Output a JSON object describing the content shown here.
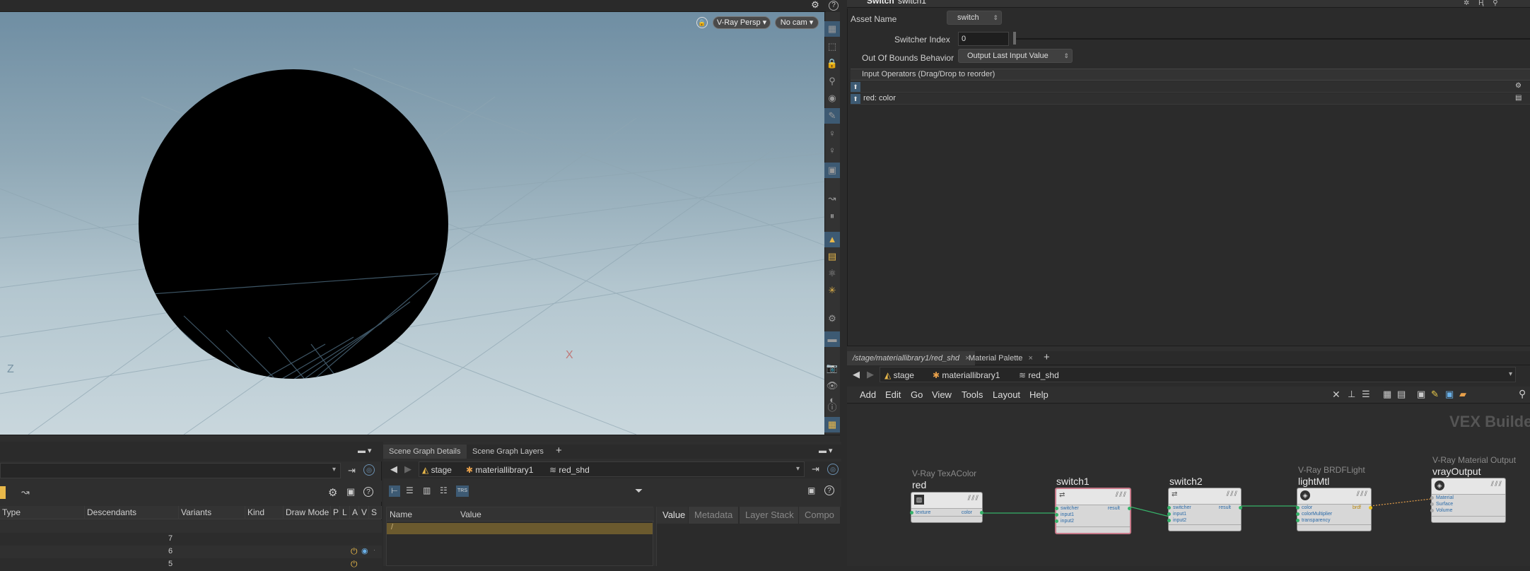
{
  "viewport": {
    "camera_menu": "V-Ray Persp",
    "cam_menu": "No cam",
    "bg_top": "#6f8ea3",
    "bg_bottom": "#c9d7dd"
  },
  "params": {
    "header_type": "Switch",
    "header_name": "switch1",
    "asset_name_label": "Asset Name",
    "asset_name_value": "switch",
    "switcher_index_label": "Switcher Index",
    "switcher_index_value": "0",
    "oob_label": "Out Of Bounds Behavior",
    "oob_value": "Output Last Input Value",
    "input_ops_label": "Input Operators (Drag/Drop to reorder)",
    "input_row_2": "red: color"
  },
  "network": {
    "tabs": [
      {
        "label": "/stage/materiallibrary1/red_shd",
        "close": "×"
      },
      {
        "label": "Material Palette",
        "close": "×"
      }
    ],
    "add_tab": "+",
    "path": [
      "stage",
      "materiallibrary1",
      "red_shd"
    ],
    "menu": [
      "Add",
      "Edit",
      "Go",
      "View",
      "Tools",
      "Layout",
      "Help"
    ],
    "watermark": "VEX Builder",
    "nodes": [
      {
        "type": "V-Ray TexAColor",
        "name": "red",
        "inputs": [
          "texture"
        ],
        "outputs": [
          "color"
        ]
      },
      {
        "type": "",
        "name": "switch1",
        "inputs": [
          "switcher",
          "input1",
          "input2"
        ],
        "outputs": [
          "result"
        ]
      },
      {
        "type": "",
        "name": "switch2",
        "inputs": [
          "switcher",
          "input1",
          "input2"
        ],
        "outputs": [
          "result"
        ]
      },
      {
        "type": "V-Ray BRDFLight",
        "name": "lightMtl",
        "inputs": [
          "color",
          "colorMultiplier",
          "transparency"
        ],
        "outputs": [
          "brdf"
        ]
      },
      {
        "type": "V-Ray Material Output",
        "name": "vrayOutput",
        "inputs": [
          "Material",
          "Surface",
          "Volume"
        ],
        "outputs": []
      }
    ],
    "wire_color": "#36b36a"
  },
  "scene_graph": {
    "columns": [
      "Type",
      "Descendants",
      "Variants",
      "Kind",
      "Draw Mode",
      "P",
      "L",
      "A",
      "V",
      "S"
    ],
    "descendants": [
      "7",
      "6",
      "5"
    ]
  },
  "details": {
    "tabs": [
      "Scene Graph Details",
      "Scene Graph Layers"
    ],
    "add_tab": "+",
    "path": [
      "stage",
      "materiallibrary1",
      "red_shd"
    ],
    "columns": [
      "Name",
      "Value"
    ],
    "row1": "/",
    "right_tabs": [
      "Value",
      "Metadata",
      "Layer Stack",
      "Compo"
    ]
  }
}
